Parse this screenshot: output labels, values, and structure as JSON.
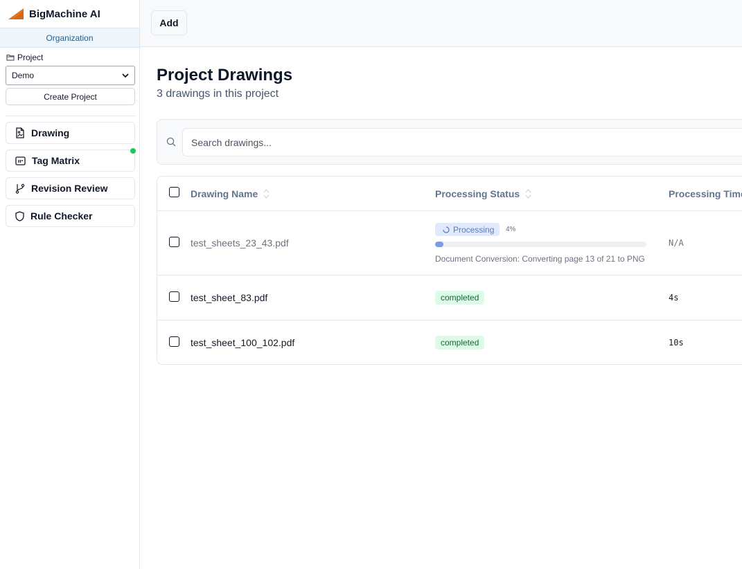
{
  "app": {
    "name": "BigMachine AI"
  },
  "sidebar": {
    "org_label": "Organization",
    "project_label": "Project",
    "project_select": {
      "value": "Demo"
    },
    "create_project_label": "Create Project",
    "nav": [
      {
        "label": "Drawing",
        "icon": "drawing-file-icon"
      },
      {
        "label": "Tag Matrix",
        "icon": "tag-matrix-icon",
        "notification": true
      },
      {
        "label": "Revision Review",
        "icon": "git-branch-icon"
      },
      {
        "label": "Rule Checker",
        "icon": "shield-icon"
      }
    ]
  },
  "toolbar": {
    "add_label": "Add"
  },
  "main": {
    "title": "Project Drawings",
    "subtitle": "3 drawings in this project",
    "search": {
      "placeholder": "Search drawings...",
      "value": ""
    },
    "table": {
      "columns": [
        "Drawing Name",
        "Processing Status",
        "Processing Time"
      ],
      "rows": [
        {
          "name": "test_sheets_23_43.pdf",
          "status": "Processing",
          "progress_percent": 4,
          "progress_label": "4%",
          "progress_text": "Document Conversion: Converting page 13 of 21 to PNG",
          "time": "N/A"
        },
        {
          "name": "test_sheet_83.pdf",
          "status": "completed",
          "time": "4s"
        },
        {
          "name": "test_sheet_100_102.pdf",
          "status": "completed",
          "time": "10s"
        }
      ]
    }
  },
  "colors": {
    "accent_orange": "#e8741a",
    "completed_bg": "#dcfce7",
    "completed_text": "#166534",
    "processing_bg": "#e0eafc",
    "progress_fill": "#7b9be6",
    "notification_dot": "#22c55e"
  }
}
